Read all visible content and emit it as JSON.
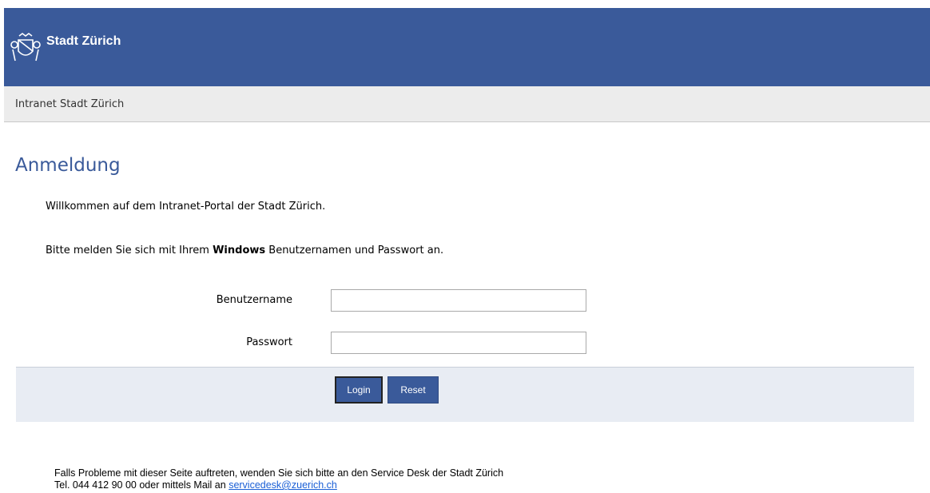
{
  "header": {
    "brand": "Stadt Zürich",
    "logo_icon": "zurich-coat-of-arms-icon",
    "background": "#3a5a9a"
  },
  "subheader": {
    "title": "Intranet Stadt Zürich"
  },
  "main": {
    "heading": "Anmeldung",
    "welcome": "Willkommen auf dem Intranet-Portal der Stadt Zürich.",
    "instruction_prefix": "Bitte melden Sie sich mit Ihrem ",
    "instruction_bold": "Windows",
    "instruction_suffix": " Benutzernamen und Passwort an."
  },
  "form": {
    "username_label": "Benutzername",
    "username_value": "",
    "password_label": "Passwort",
    "password_value": "",
    "login_label": "Login",
    "reset_label": "Reset"
  },
  "footer": {
    "line1": "Falls Probleme mit dieser Seite auftreten, wenden Sie sich bitte an den Service Desk der Stadt Zürich",
    "line2_prefix": "Tel. 044 412 90 00 oder mittels Mail an ",
    "email": "servicedesk@zuerich.ch"
  }
}
